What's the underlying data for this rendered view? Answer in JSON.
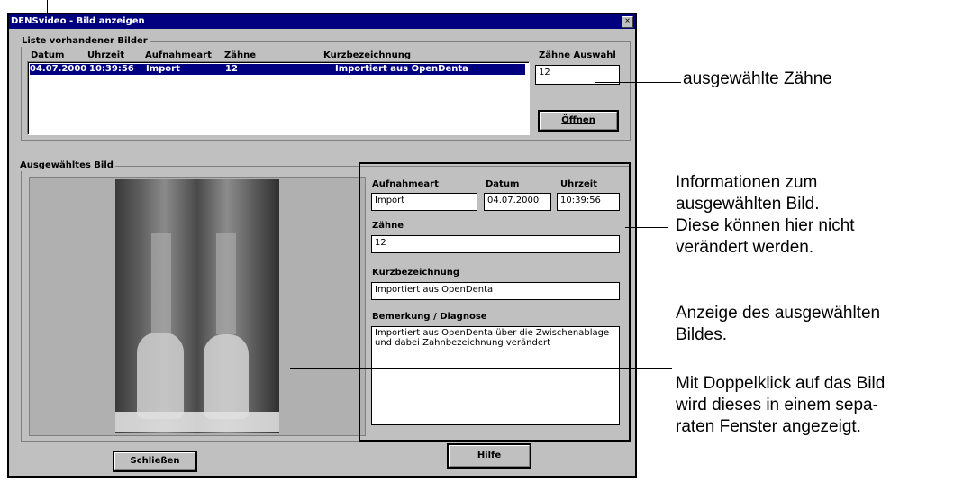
{
  "window": {
    "title": "DENSvideo - Bild anzeigen",
    "close_glyph": "×"
  },
  "list_group": {
    "legend": "Liste vorhandener Bilder",
    "columns": [
      "Datum",
      "Uhrzeit",
      "Aufnahmeart",
      "Zähne",
      "Kurzbezeichnung"
    ],
    "rows": [
      {
        "datum": "04.07.2000",
        "uhrzeit": "10:39:56",
        "aufnahmeart": "Import",
        "zaehne": "12",
        "kurzbezeichnung": "Importiert aus OpenDenta"
      }
    ]
  },
  "zaehne_auswahl": {
    "label": "Zähne Auswahl",
    "value": "12"
  },
  "open_button": {
    "label": "Öffnen"
  },
  "image_group": {
    "legend": "Ausgewähltes Bild"
  },
  "details": {
    "aufnahmeart_label": "Aufnahmeart",
    "aufnahmeart_value": "Import",
    "datum_label": "Datum",
    "datum_value": "04.07.2000",
    "uhrzeit_label": "Uhrzeit",
    "uhrzeit_value": "10:39:56",
    "zaehne_label": "Zähne",
    "zaehne_value": "12",
    "kurz_label": "Kurzbezeichnung",
    "kurz_value": "Importiert aus OpenDenta",
    "bemerkung_label": "Bemerkung / Diagnose",
    "bemerkung_value": "Importiert aus OpenDenta über die Zwischenablage und dabei Zahnbezeichnung verändert"
  },
  "buttons": {
    "close": "Schließen",
    "help": "Hilfe"
  },
  "annotations": {
    "selected_teeth": "ausgewählte Zähne",
    "info_1": "Informationen zum",
    "info_2": "ausgewählten Bild.",
    "info_3": "Diese können hier nicht",
    "info_4": "verändert werden.",
    "display_1": "Anzeige des ausgewählten",
    "display_2": "Bildes.",
    "dbl_1": "Mit Doppelklick auf das Bild",
    "dbl_2": "wird dieses in einem sepa-",
    "dbl_3": "raten Fenster angezeigt."
  }
}
